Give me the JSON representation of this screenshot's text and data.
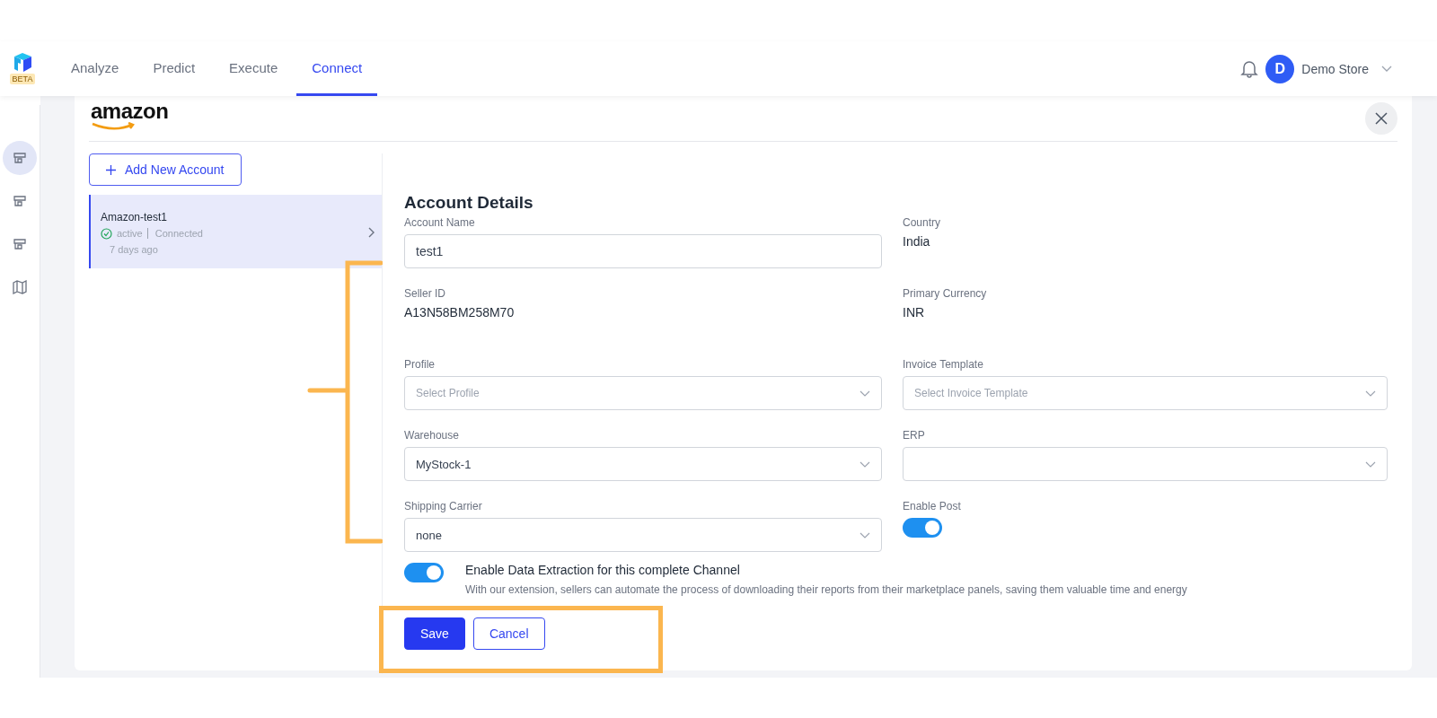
{
  "logo_badge": "BETA",
  "nav": [
    {
      "label": "Analyze",
      "selected": false
    },
    {
      "label": "Predict",
      "selected": false
    },
    {
      "label": "Execute",
      "selected": false
    },
    {
      "label": "Connect",
      "selected": true
    }
  ],
  "user": {
    "initial": "D",
    "name": "Demo Store"
  },
  "rail": [
    {
      "selected": true
    },
    {
      "selected": false
    },
    {
      "selected": false
    },
    {
      "selected": false
    }
  ],
  "brand": "amazon",
  "add_button": "Add New Account",
  "accounts": [
    {
      "name": "Amazon-test1",
      "status": "active",
      "connection": "Connected",
      "time": "7 days ago",
      "selected": true
    }
  ],
  "details_title": "Account Details",
  "fields": [
    {
      "kind": "input",
      "label": "Account Name",
      "value": "test1"
    },
    {
      "kind": "text",
      "label": "Country",
      "value": "India"
    },
    {
      "kind": "text",
      "label": "Seller ID",
      "value": "A13N58BM258M70"
    },
    {
      "kind": "text",
      "label": "Primary Currency",
      "value": "INR"
    },
    {
      "kind": "select",
      "label": "Profile",
      "placeholder": "Select Profile"
    },
    {
      "kind": "select",
      "label": "Invoice Template",
      "placeholder": "Select Invoice Template"
    },
    {
      "kind": "select",
      "label": "Warehouse",
      "value": "MyStock-1"
    },
    {
      "kind": "select",
      "label": "ERP"
    },
    {
      "kind": "select",
      "label": "Shipping Carrier",
      "value": "none"
    },
    {
      "kind": "toggle",
      "label": "Enable Post",
      "on": true
    }
  ],
  "extraction": {
    "on": true,
    "title": "Enable Data Extraction for this complete Channel",
    "description": "With our extension, sellers can automate the process of downloading their reports from their marketplace panels, saving them valuable time and energy"
  },
  "buttons": [
    {
      "kind": "primary",
      "label": "Save"
    },
    {
      "kind": "secondary",
      "label": "Cancel"
    }
  ]
}
